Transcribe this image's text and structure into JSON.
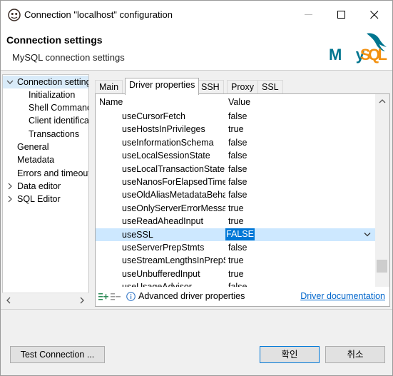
{
  "window": {
    "title": "Connection \"localhost\" configuration"
  },
  "header": {
    "title": "Connection settings",
    "subtitle": "MySQL connection settings",
    "logo_text": "MySQL"
  },
  "nav": {
    "items": [
      {
        "label": "Connection settings",
        "expanded": true,
        "selected": true,
        "indent": 0
      },
      {
        "label": "Initialization",
        "indent": 1
      },
      {
        "label": "Shell Commands",
        "indent": 1
      },
      {
        "label": "Client identification",
        "indent": 1
      },
      {
        "label": "Transactions",
        "indent": 1
      },
      {
        "label": "General",
        "indent": 0
      },
      {
        "label": "Metadata",
        "indent": 0
      },
      {
        "label": "Errors and timeouts",
        "indent": 0
      },
      {
        "label": "Data editor",
        "collapsed": true,
        "indent": 0
      },
      {
        "label": "SQL Editor",
        "collapsed": true,
        "indent": 0
      }
    ]
  },
  "tabs": [
    {
      "label": "Main"
    },
    {
      "label": "Driver properties",
      "active": true
    },
    {
      "label": "SSH"
    },
    {
      "label": "Proxy"
    },
    {
      "label": "SSL"
    }
  ],
  "table": {
    "columns": {
      "name": "Name",
      "value": "Value"
    },
    "rows": [
      {
        "name": "useCursorFetch",
        "value": "false"
      },
      {
        "name": "useHostsInPrivileges",
        "value": "true"
      },
      {
        "name": "useInformationSchema",
        "value": "false"
      },
      {
        "name": "useLocalSessionState",
        "value": "false"
      },
      {
        "name": "useLocalTransactionState",
        "value": "false"
      },
      {
        "name": "useNanosForElapsedTime",
        "value": "false"
      },
      {
        "name": "useOldAliasMetadataBehavior",
        "value": "false"
      },
      {
        "name": "useOnlyServerErrorMessages",
        "value": "true"
      },
      {
        "name": "useReadAheadInput",
        "value": "true"
      },
      {
        "name": "useSSL",
        "value": "FALSE",
        "selected": true
      },
      {
        "name": "useServerPrepStmts",
        "value": "false"
      },
      {
        "name": "useStreamLengthsInPrepStmts",
        "value": "true"
      },
      {
        "name": "useUnbufferedInput",
        "value": "true"
      },
      {
        "name": "useUsageAdvisor",
        "value": "false"
      }
    ]
  },
  "panel_footer": {
    "advanced_label": "Advanced driver properties",
    "doc_link": "Driver documentation"
  },
  "buttons": {
    "test_connection": "Test Connection ...",
    "ok": "확인",
    "cancel": "취소"
  },
  "colors": {
    "selection_blue": "#0078d7",
    "link": "#0066cc",
    "mysql_blue": "#00758f",
    "mysql_orange": "#f29111"
  }
}
